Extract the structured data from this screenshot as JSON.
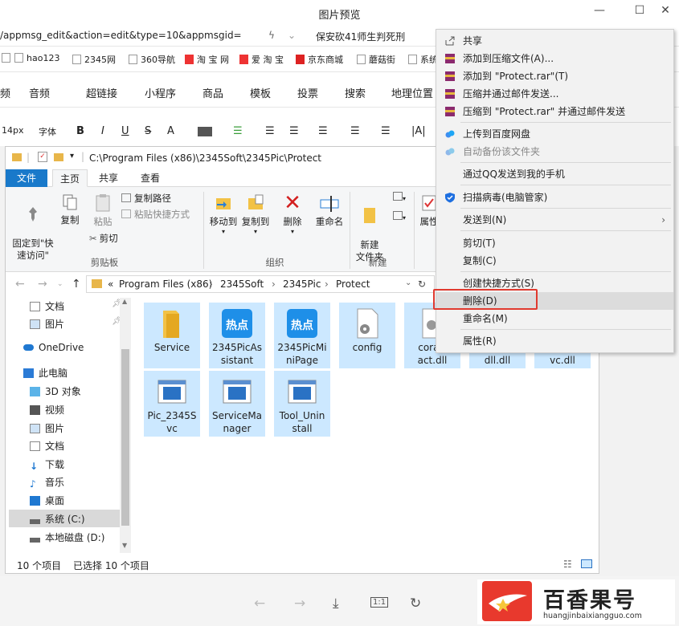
{
  "viewer": {
    "title": "图片预览",
    "min": "—",
    "max": "☐",
    "close": "✕"
  },
  "browser": {
    "url_fragment": "/appmsg_edit&action=edit&type=10&appmsgid=",
    "news": "保安砍41师生判死刑",
    "bookmarks": [
      "hao123",
      "2345网",
      "360导航",
      "淘 宝 网",
      "爱 淘 宝",
      "京东商城",
      "蘑菇街",
      "系统"
    ],
    "editor_tabs": [
      "频",
      "音频",
      "超链接",
      "小程序",
      "商品",
      "模板",
      "投票",
      "搜索",
      "地理位置"
    ],
    "format": {
      "size": "14px",
      "font": "字体",
      "bold": "B",
      "italic": "I",
      "underline": "U",
      "strike": "S",
      "color": "A"
    }
  },
  "explorer": {
    "path_title": "C:\\Program Files (x86)\\2345Soft\\2345Pic\\Protect",
    "ribbon_tabs": {
      "file": "文件",
      "home": "主页",
      "share": "共享",
      "view": "查看"
    },
    "ribbon": {
      "pin": "固定到\"快\n速访问\"",
      "copy": "复制",
      "paste": "粘贴",
      "copy_path": "复制路径",
      "paste_shortcut": "粘贴快捷方式",
      "cut": "剪切",
      "clipboard": "剪贴板",
      "move_to": "移动到",
      "copy_to": "复制到",
      "delete": "删除",
      "rename": "重命名",
      "organize": "组织",
      "new_folder": "新建\n文件夹",
      "new": "新建",
      "properties": "属性"
    },
    "address": [
      "«",
      "Program Files (x86)",
      "›",
      "2345Soft",
      "›",
      "2345Pic",
      "›",
      "Protect"
    ],
    "nav": [
      {
        "label": "文档",
        "icon": "document-icon"
      },
      {
        "label": "图片",
        "icon": "picture-icon"
      },
      {
        "label": "OneDrive",
        "icon": "cloud-icon"
      },
      {
        "label": "此电脑",
        "icon": "computer-icon"
      },
      {
        "label": "3D 对象",
        "icon": "cube-icon"
      },
      {
        "label": "视频",
        "icon": "video-icon"
      },
      {
        "label": "图片",
        "icon": "picture-icon"
      },
      {
        "label": "文档",
        "icon": "document-icon"
      },
      {
        "label": "下载",
        "icon": "download-icon"
      },
      {
        "label": "音乐",
        "icon": "music-icon"
      },
      {
        "label": "桌面",
        "icon": "desktop-icon"
      },
      {
        "label": "系统 (C:)",
        "icon": "drive-icon"
      },
      {
        "label": "本地磁盘 (D:)",
        "icon": "drive-icon"
      }
    ],
    "files": [
      {
        "name": "Service",
        "icon": "folder-icon"
      },
      {
        "name": "2345PicAssistant",
        "l1": "2345PicAs",
        "l2": "sistant",
        "icon": "hotspot-icon"
      },
      {
        "name": "2345PicMiniPage",
        "l1": "2345PicMi",
        "l2": "niPage",
        "icon": "hotspot-icon"
      },
      {
        "name": "config",
        "icon": "settings-file-icon"
      },
      {
        "name": "coral_act.dll",
        "l1": "coral_",
        "l2": "act.dll",
        "icon": "dll-icon"
      },
      {
        "name": "dll.dll",
        "icon": "dll-icon"
      },
      {
        "name": "vc.dll",
        "icon": "dll-icon"
      },
      {
        "name": "Pic_2345Svc",
        "l1": "Pic_2345S",
        "l2": "vc",
        "icon": "app-icon"
      },
      {
        "name": "ServiceManager",
        "l1": "ServiceMa",
        "l2": "nager",
        "icon": "app-icon"
      },
      {
        "name": "Tool_Uninstall",
        "l1": "Tool_Unin",
        "l2": "stall",
        "icon": "app-icon"
      }
    ],
    "status": {
      "count": "10 个项目",
      "selected": "已选择 10 个项目"
    }
  },
  "context_menu": [
    "共享",
    "添加到压缩文件(A)...",
    "添加到 \"Protect.rar\"(T)",
    "压缩并通过邮件发送...",
    "压缩到 \"Protect.rar\" 并通过邮件发送",
    "上传到百度网盘",
    "自动备份该文件夹",
    "通过QQ发送到我的手机",
    "扫描病毒(电脑管家)",
    "发送到(N)",
    "剪切(T)",
    "复制(C)",
    "创建快捷方式(S)",
    "删除(D)",
    "重命名(M)",
    "属性(R)"
  ],
  "watermark": {
    "title": "百香果号",
    "url": "huangjinbaixiangguo.com"
  },
  "colors": {
    "accent": "#1979ca",
    "selection": "#cce8ff",
    "highlight_box": "#e03a2f",
    "brand": "#e8392d"
  }
}
